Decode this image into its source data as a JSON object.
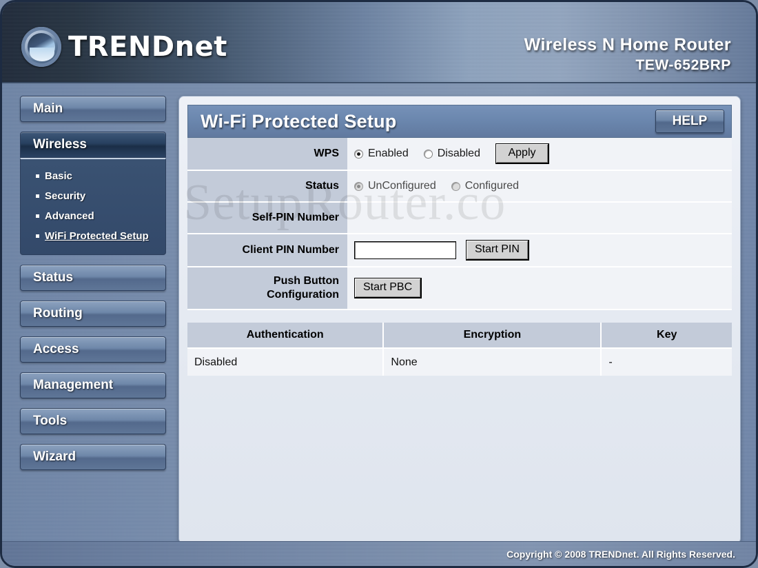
{
  "brand": {
    "logo_text": "TRENDnet",
    "logo_icon": "trendnet-wave-logo",
    "product_title": "Wireless N Home Router",
    "model": "TEW-652BRP"
  },
  "sidebar": {
    "items": [
      {
        "label": "Main",
        "active": false
      },
      {
        "label": "Wireless",
        "active": true
      },
      {
        "label": "Status",
        "active": false
      },
      {
        "label": "Routing",
        "active": false
      },
      {
        "label": "Access",
        "active": false
      },
      {
        "label": "Management",
        "active": false
      },
      {
        "label": "Tools",
        "active": false
      },
      {
        "label": "Wizard",
        "active": false
      }
    ],
    "wireless_submenu": [
      {
        "label": "Basic",
        "selected": false
      },
      {
        "label": "Security",
        "selected": false
      },
      {
        "label": "Advanced",
        "selected": false
      },
      {
        "label": "WiFi Protected Setup",
        "selected": true
      }
    ]
  },
  "panel": {
    "title": "Wi-Fi Protected Setup",
    "help_label": "HELP"
  },
  "form": {
    "wps": {
      "label": "WPS",
      "options": [
        {
          "label": "Enabled",
          "checked": true
        },
        {
          "label": "Disabled",
          "checked": false
        }
      ],
      "apply_label": "Apply"
    },
    "status": {
      "label": "Status",
      "options": [
        {
          "label": "UnConfigured",
          "checked": true
        },
        {
          "label": "Configured",
          "checked": false
        }
      ]
    },
    "self_pin": {
      "label": "Self-PIN Number",
      "value": ""
    },
    "client_pin": {
      "label": "Client PIN Number",
      "value": "",
      "placeholder": "",
      "button_label": "Start PIN"
    },
    "pbc": {
      "label": "Push Button Configuration",
      "label_line1": "Push Button",
      "label_line2": "Configuration",
      "button_label": "Start PBC"
    }
  },
  "results_table": {
    "headers": [
      "Authentication",
      "Encryption",
      "Key"
    ],
    "rows": [
      [
        "Disabled",
        "None",
        "-"
      ]
    ]
  },
  "watermark": {
    "text": "SetupRouter.co"
  },
  "footer": {
    "copyright": "Copyright © 2008 TRENDnet. All Rights Reserved."
  },
  "colors": {
    "header_dark": "#1b2636",
    "header_light": "#93a7c2",
    "panel_header": "#6a86ad",
    "label_cell": "#c3cbd9",
    "value_cell": "#f1f3f7",
    "page_bg": "#7b90af",
    "nav_active": "#27405f"
  }
}
